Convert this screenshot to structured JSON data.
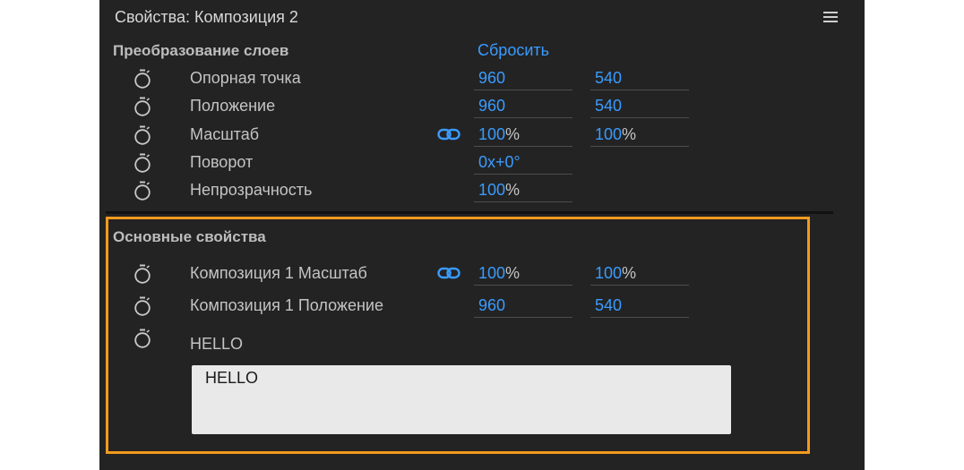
{
  "panel": {
    "title": "Свойства: Композиция 2"
  },
  "transform": {
    "title": "Преобразование слоев",
    "reset_label": "Сбросить",
    "rows": [
      {
        "label": "Опорная точка",
        "v1": "960",
        "u1": "",
        "v2": "540",
        "u2": "",
        "linked": false
      },
      {
        "label": "Положение",
        "v1": "960",
        "u1": "",
        "v2": "540",
        "u2": "",
        "linked": false
      },
      {
        "label": "Масштаб",
        "v1": "100",
        "u1": "%",
        "v2": "100",
        "u2": "%",
        "linked": true
      },
      {
        "label": "Поворот",
        "v1": "0x+0°",
        "u1": "",
        "v2": null,
        "u2": null,
        "linked": false
      },
      {
        "label": "Непрозрачность",
        "v1": "100",
        "u1": "%",
        "v2": null,
        "u2": null,
        "linked": false
      }
    ]
  },
  "essential": {
    "title": "Основные свойства",
    "rows": [
      {
        "label": "Композиция 1 Масштаб",
        "v1": "100",
        "u1": "%",
        "v2": "100",
        "u2": "%",
        "linked": true
      },
      {
        "label": "Композиция 1 Положение",
        "v1": "960",
        "u1": "",
        "v2": "540",
        "u2": "",
        "linked": false
      }
    ],
    "text_property": {
      "label": "HELLO",
      "value": "HELLO"
    }
  },
  "colors": {
    "accent": "#3a9bff",
    "highlight": "#f39a1e",
    "panel_bg": "#232323"
  },
  "icons": {
    "stopwatch": "stopwatch-icon",
    "link": "link-icon",
    "menu": "hamburger-menu-icon"
  }
}
